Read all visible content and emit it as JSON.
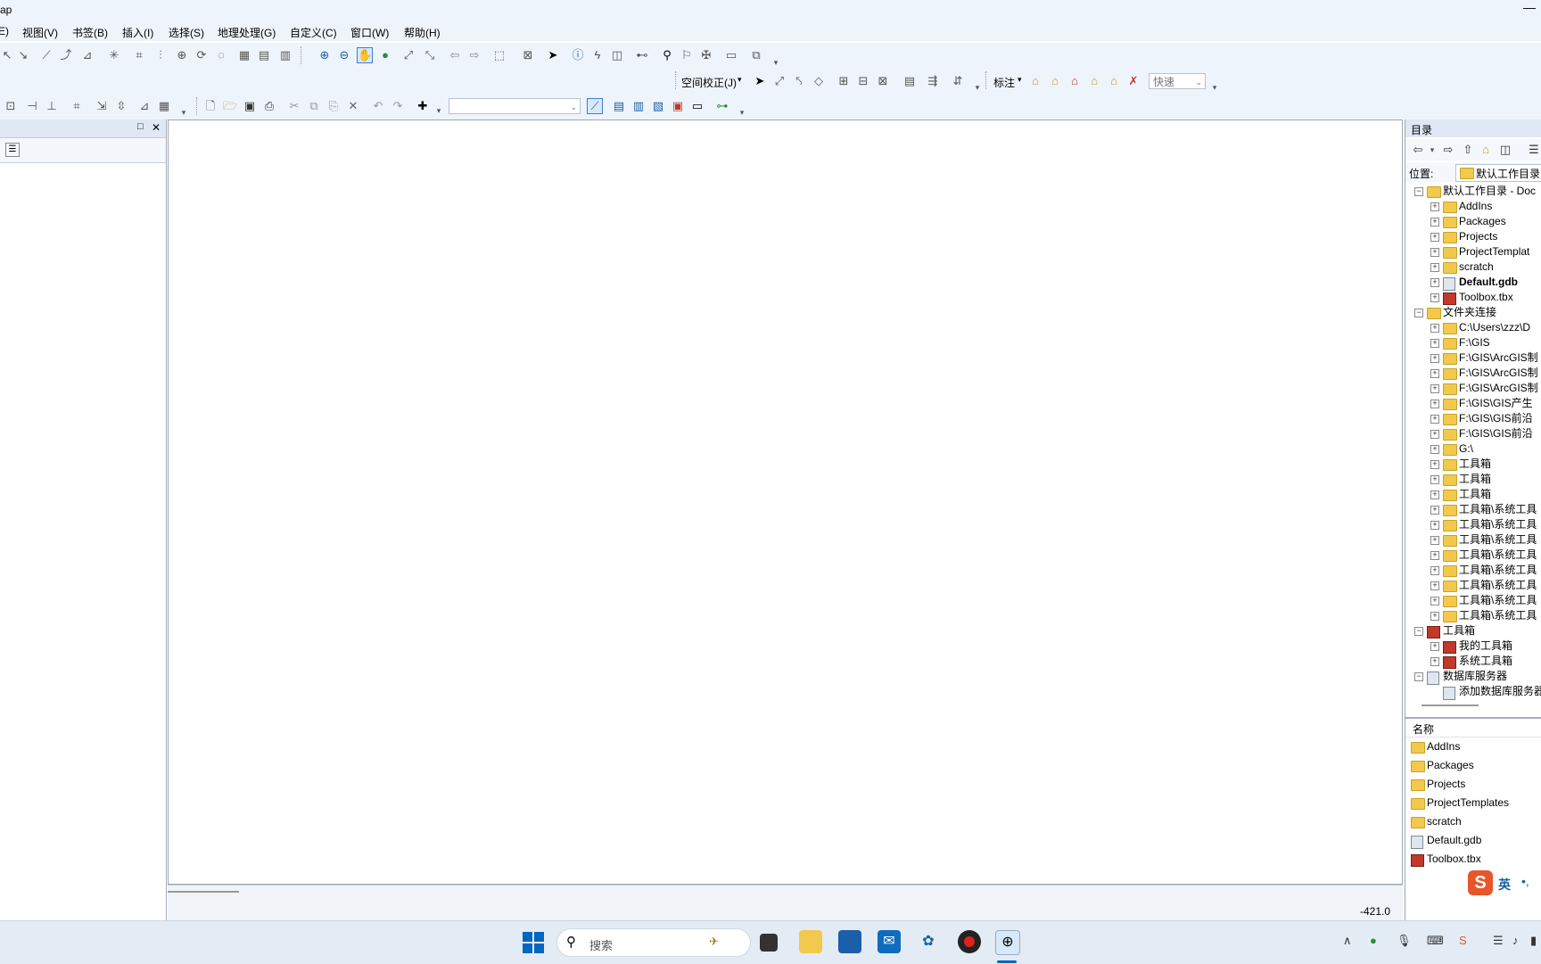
{
  "window": {
    "title": "Map",
    "minimize": "—"
  },
  "menu": [
    "E)",
    "视图(V)",
    "书签(B)",
    "插入(I)",
    "选择(S)",
    "地理处理(G)",
    "自定义(C)",
    "窗口(W)",
    "帮助(H)"
  ],
  "toolbar": {
    "spatial_adjust": "空间校正(J)",
    "label": "标注",
    "quick_combo": "快速"
  },
  "left_panel": {
    "restore": "□",
    "close": "✕"
  },
  "statusbar": {
    "coordinate": "-421.0"
  },
  "catalog": {
    "header": "目录",
    "location_label": "位置:",
    "location_value": "默认工作目录",
    "tree": [
      {
        "level": 0,
        "type": "folder-home",
        "label": "默认工作目录 - Doc",
        "exp": "−"
      },
      {
        "level": 1,
        "type": "folder",
        "label": "AddIns",
        "exp": "+"
      },
      {
        "level": 1,
        "type": "folder",
        "label": "Packages",
        "exp": "+"
      },
      {
        "level": 1,
        "type": "folder",
        "label": "Projects",
        "exp": "+"
      },
      {
        "level": 1,
        "type": "folder",
        "label": "ProjectTemplat",
        "exp": "+"
      },
      {
        "level": 1,
        "type": "folder",
        "label": "scratch",
        "exp": "+"
      },
      {
        "level": 1,
        "type": "gdb",
        "label": "Default.gdb",
        "exp": "+",
        "bold": true
      },
      {
        "level": 1,
        "type": "tbx",
        "label": "Toolbox.tbx",
        "exp": "+"
      },
      {
        "level": 0,
        "type": "folder",
        "label": "文件夹连接",
        "exp": "−"
      },
      {
        "level": 1,
        "type": "folder",
        "label": "C:\\Users\\zzz\\D",
        "exp": "+"
      },
      {
        "level": 1,
        "type": "folder",
        "label": "F:\\GIS",
        "exp": "+"
      },
      {
        "level": 1,
        "type": "folder",
        "label": "F:\\GIS\\ArcGIS制",
        "exp": "+"
      },
      {
        "level": 1,
        "type": "folder",
        "label": "F:\\GIS\\ArcGIS制",
        "exp": "+"
      },
      {
        "level": 1,
        "type": "folder",
        "label": "F:\\GIS\\ArcGIS制",
        "exp": "+"
      },
      {
        "level": 1,
        "type": "folder",
        "label": "F:\\GIS\\GIS产生",
        "exp": "+"
      },
      {
        "level": 1,
        "type": "folder",
        "label": "F:\\GIS\\GIS前沿",
        "exp": "+"
      },
      {
        "level": 1,
        "type": "folder",
        "label": "F:\\GIS\\GIS前沿",
        "exp": "+"
      },
      {
        "level": 1,
        "type": "folder",
        "label": "G:\\",
        "exp": "+"
      },
      {
        "level": 1,
        "type": "folder",
        "label": "工具箱",
        "exp": "+"
      },
      {
        "level": 1,
        "type": "folder",
        "label": "工具箱",
        "exp": "+"
      },
      {
        "level": 1,
        "type": "folder",
        "label": "工具箱",
        "exp": "+"
      },
      {
        "level": 1,
        "type": "folder",
        "label": "工具箱\\系统工具",
        "exp": "+"
      },
      {
        "level": 1,
        "type": "folder",
        "label": "工具箱\\系统工具",
        "exp": "+"
      },
      {
        "level": 1,
        "type": "folder",
        "label": "工具箱\\系统工具",
        "exp": "+"
      },
      {
        "level": 1,
        "type": "folder",
        "label": "工具箱\\系统工具",
        "exp": "+"
      },
      {
        "level": 1,
        "type": "folder",
        "label": "工具箱\\系统工具",
        "exp": "+"
      },
      {
        "level": 1,
        "type": "folder",
        "label": "工具箱\\系统工具",
        "exp": "+"
      },
      {
        "level": 1,
        "type": "folder",
        "label": "工具箱\\系统工具",
        "exp": "+"
      },
      {
        "level": 1,
        "type": "folder",
        "label": "工具箱\\系统工具",
        "exp": "+"
      },
      {
        "level": 0,
        "type": "tbx",
        "label": "工具箱",
        "exp": "−"
      },
      {
        "level": 1,
        "type": "tbx",
        "label": "我的工具箱",
        "exp": "+"
      },
      {
        "level": 1,
        "type": "tbx",
        "label": "系统工具箱",
        "exp": "+"
      },
      {
        "level": 0,
        "type": "gdb",
        "label": "数据库服务器",
        "exp": "−"
      },
      {
        "level": 1,
        "type": "gdb",
        "label": "添加数据库服务器",
        "exp": ""
      }
    ],
    "contents_header": "名称",
    "contents": [
      {
        "type": "folder",
        "label": "AddIns"
      },
      {
        "type": "folder",
        "label": "Packages"
      },
      {
        "type": "folder",
        "label": "Projects"
      },
      {
        "type": "folder",
        "label": "ProjectTemplates"
      },
      {
        "type": "folder",
        "label": "scratch"
      },
      {
        "type": "gdb",
        "label": "Default.gdb"
      },
      {
        "type": "tbx",
        "label": "Toolbox.tbx"
      }
    ]
  },
  "ime": {
    "lang": "英",
    "extra": "•,"
  },
  "taskbar": {
    "search_placeholder": "搜索"
  },
  "colors": {
    "chrome": "#eef4fb",
    "accent": "#0067c0"
  }
}
